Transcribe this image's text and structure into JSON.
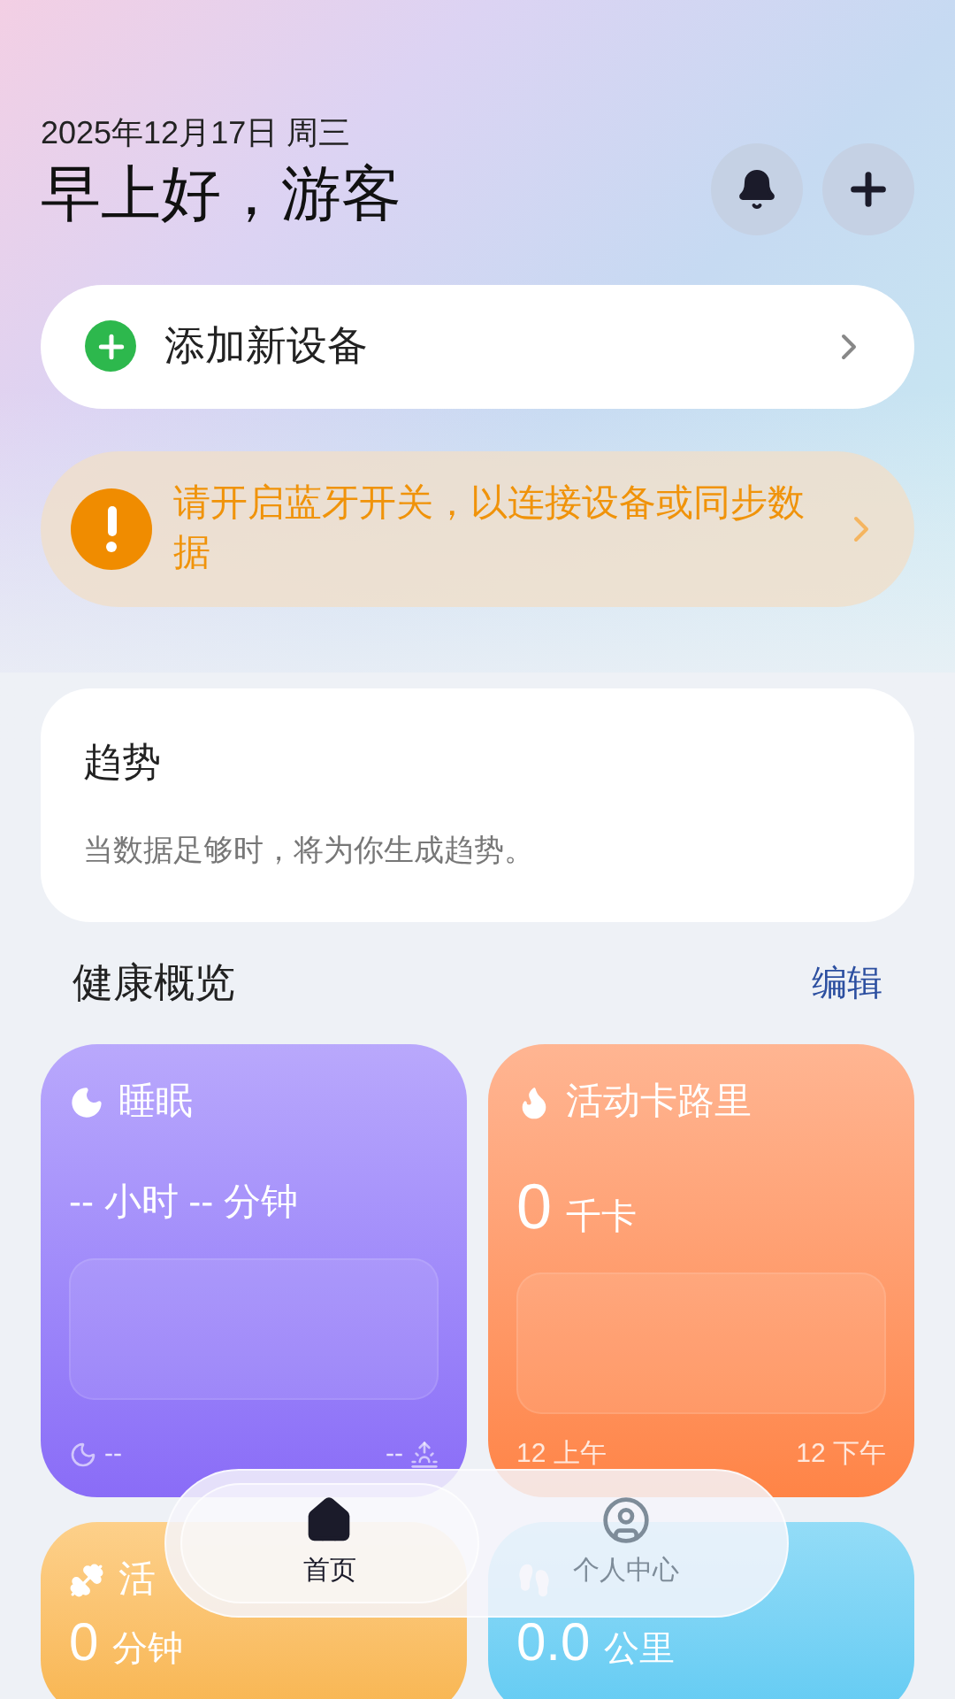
{
  "header": {
    "date": "2025年12月17日 周三",
    "greeting": "早上好，游客"
  },
  "add_device": {
    "label": "添加新设备"
  },
  "bluetooth_alert": {
    "message": "请开启蓝牙开关，以连接设备或同步数据"
  },
  "trend": {
    "title": "趋势",
    "message": "当数据足够时，将为你生成趋势。"
  },
  "overview": {
    "title": "健康概览",
    "edit": "编辑"
  },
  "cards": [
    {
      "kind": "sleep",
      "title": "睡眠",
      "value": "-- 小时 -- 分钟",
      "footer_left": "--",
      "footer_right": "--"
    },
    {
      "kind": "calories",
      "title": "活动卡路里",
      "value": "0",
      "unit": "千卡",
      "footer_left": "12 上午",
      "footer_right": "12 下午"
    },
    {
      "kind": "active",
      "title": "活",
      "value": "0",
      "unit": "分钟"
    },
    {
      "kind": "distance",
      "value": "0.0",
      "unit": "公里"
    }
  ],
  "nav": [
    {
      "label": "首页",
      "selected": true
    },
    {
      "label": "个人中心",
      "selected": false
    }
  ]
}
